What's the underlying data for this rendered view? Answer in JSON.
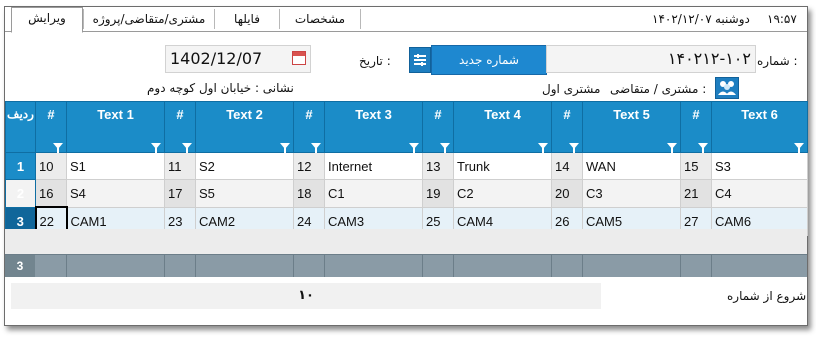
{
  "tabs": [
    {
      "label": "ویرایش",
      "active": true
    },
    {
      "label": "مشتری/متقاضی/پروژه",
      "active": false
    },
    {
      "label": "فایلها",
      "active": false
    },
    {
      "label": "مشخصات",
      "active": false
    }
  ],
  "status": {
    "date": "۱۴۰۲/۱۲/۰۷",
    "weekday": "دوشنبه",
    "time": "۱۹:۵۷"
  },
  "form": {
    "number_label": "شماره :",
    "number_value": "۱۴۰۲۱۲-۱۰۲",
    "new_number_button": "شماره جدید",
    "date_label": "تاریخ :",
    "date_value": "1402/12/07",
    "customer_label": "مشتری / متقاضی :",
    "customer_value": "مشتری اول",
    "address_text": "نشانی : خیابان اول کوچه دوم"
  },
  "grid": {
    "row_header": "ردیف",
    "columns": [
      {
        "num_header": "#",
        "text_header": "Text 1"
      },
      {
        "num_header": "#",
        "text_header": "Text 2"
      },
      {
        "num_header": "#",
        "text_header": "Text 3"
      },
      {
        "num_header": "#",
        "text_header": "Text 4"
      },
      {
        "num_header": "#",
        "text_header": "Text 5"
      },
      {
        "num_header": "#",
        "text_header": "Text 6"
      }
    ],
    "rows": [
      {
        "index": "1",
        "cells": [
          [
            "10",
            "S1"
          ],
          [
            "11",
            "S2"
          ],
          [
            "12",
            "Internet"
          ],
          [
            "13",
            "Trunk"
          ],
          [
            "14",
            "WAN"
          ],
          [
            "15",
            "S3"
          ]
        ]
      },
      {
        "index": "2",
        "cells": [
          [
            "16",
            "S4"
          ],
          [
            "17",
            "S5"
          ],
          [
            "18",
            "C1"
          ],
          [
            "19",
            "C2"
          ],
          [
            "20",
            "C3"
          ],
          [
            "21",
            "C4"
          ]
        ]
      },
      {
        "index": "3",
        "cells": [
          [
            "22",
            "CAM1"
          ],
          [
            "23",
            "CAM2"
          ],
          [
            "24",
            "CAM3"
          ],
          [
            "25",
            "CAM4"
          ],
          [
            "26",
            "CAM5"
          ],
          [
            "27",
            "CAM6"
          ]
        ]
      }
    ],
    "summary_count": "3"
  },
  "footer": {
    "start_label": "شروع از شماره",
    "start_value": "۱۰"
  },
  "colors": {
    "header_blue": "#1b8cc8",
    "button_blue": "#1e88d0",
    "summary_gray": "#8a9ba6"
  }
}
